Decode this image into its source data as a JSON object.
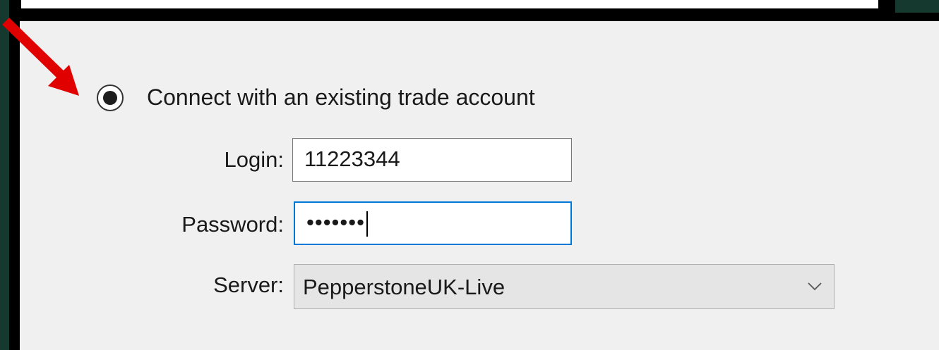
{
  "connect_option": {
    "label": "Connect with an existing trade account",
    "selected": true
  },
  "fields": {
    "login": {
      "label": "Login:",
      "value": "11223344"
    },
    "password": {
      "label": "Password:",
      "value": "•••••••",
      "focused": true
    },
    "server": {
      "label": "Server:",
      "value": "PepperstoneUK-Live"
    }
  },
  "colors": {
    "panel_background": "#f0f0f0",
    "focus_border": "#0078d7",
    "annotation_arrow": "#e00000",
    "edge_green": "#16392f"
  },
  "icons": {
    "dropdown": "chevron-down-icon",
    "annotation": "red-arrow-icon"
  }
}
